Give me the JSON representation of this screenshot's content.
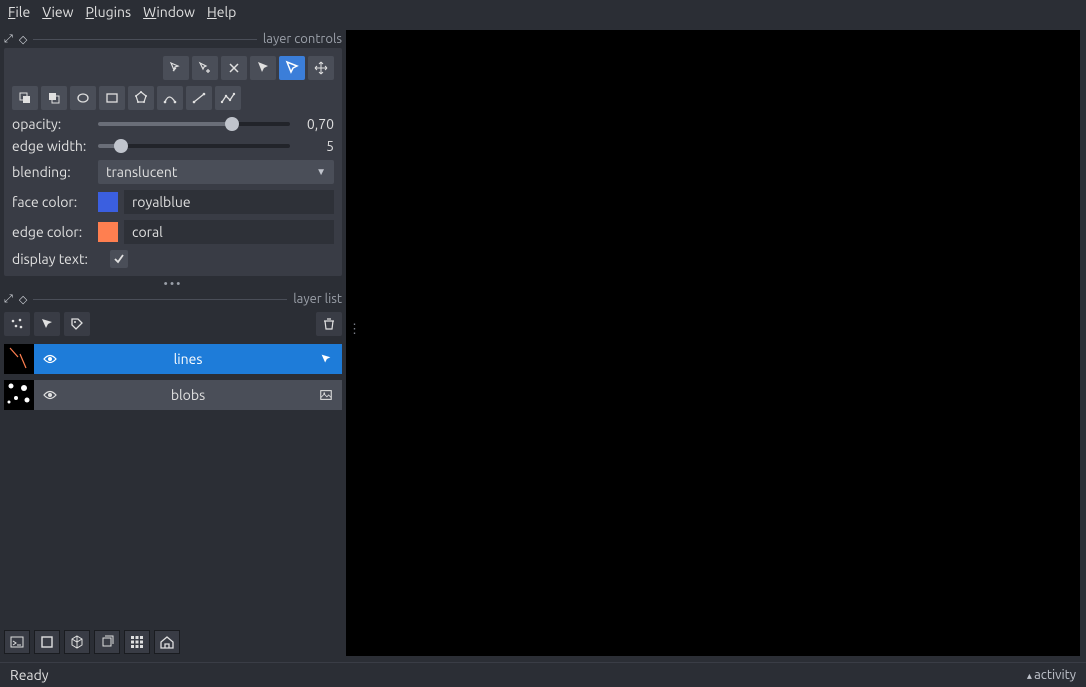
{
  "menu": {
    "file": "File",
    "view": "View",
    "plugins": "Plugins",
    "window": "Window",
    "help": "Help"
  },
  "panels": {
    "layer_controls": {
      "title": "layer controls"
    },
    "layer_list": {
      "title": "layer list"
    }
  },
  "controls": {
    "opacity_label": "opacity:",
    "opacity_value": "0,70",
    "edge_width_label": "edge width:",
    "edge_width_value": "5",
    "blending_label": "blending:",
    "blending_value": "translucent",
    "face_color_label": "face color:",
    "face_color_value": "royalblue",
    "face_color_hex": "#3b5fe0",
    "edge_color_label": "edge color:",
    "edge_color_value": "coral",
    "edge_color_hex": "#ff7f50",
    "display_text_label": "display text:",
    "display_text_checked": true
  },
  "layers": [
    {
      "name": "lines",
      "selected": true,
      "type": "shapes"
    },
    {
      "name": "blobs",
      "selected": false,
      "type": "image"
    }
  ],
  "status": {
    "text": "Ready",
    "activity": "activity"
  }
}
